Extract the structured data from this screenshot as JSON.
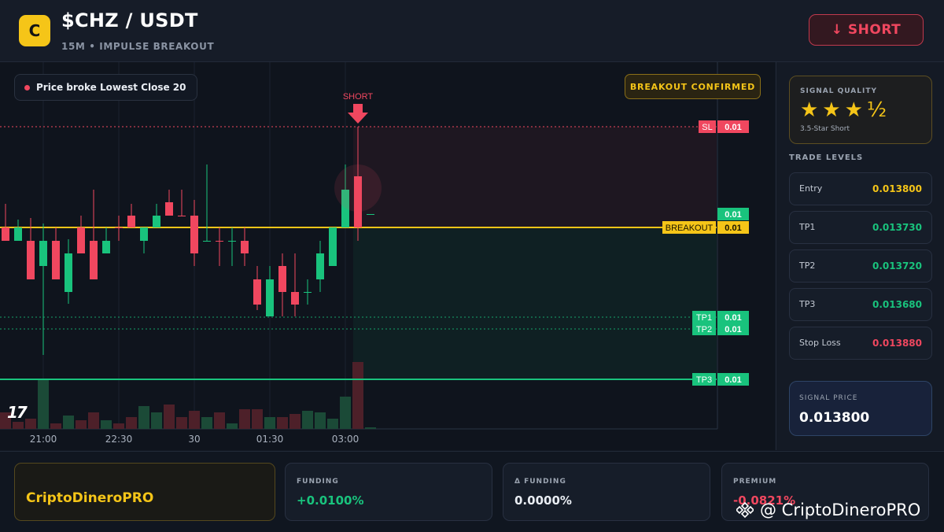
{
  "header": {
    "logo_letter": "C",
    "pair": "$CHZ / USDT",
    "subtitle": "15M • IMPULSE BREAKOUT",
    "action_label": "↓ SHORT"
  },
  "chart": {
    "info_badge": "Price broke Lowest Close 20",
    "confirm_badge": "BREAKOUT CONFIRMED",
    "signal_marker": "SHORT",
    "tv_logo": "17",
    "x_labels": [
      "21:00",
      "22:30",
      "30",
      "01:30",
      "03:00"
    ],
    "level_lines": [
      {
        "label": "SL",
        "value": "0.01",
        "color": "#f0475f"
      },
      {
        "label": "",
        "value": "0.01",
        "color": "#19c37d"
      },
      {
        "label": "BREAKOUT",
        "value": "0.01",
        "color": "#f5c518"
      },
      {
        "label": "TP1",
        "value": "0.01",
        "color": "#19c37d"
      },
      {
        "label": "TP2",
        "value": "0.01",
        "color": "#19c37d"
      },
      {
        "label": "TP3",
        "value": "0.01",
        "color": "#19c37d"
      }
    ]
  },
  "side": {
    "quality_title": "SIGNAL QUALITY",
    "stars": "★★★½",
    "rating": 3.5,
    "quality_note": "3.5-Star Short",
    "levels_title": "TRADE LEVELS",
    "levels": [
      {
        "name": "Entry",
        "value": "0.013800",
        "color": "#f5c518"
      },
      {
        "name": "TP1",
        "value": "0.013730",
        "color": "#19c37d"
      },
      {
        "name": "TP2",
        "value": "0.013720",
        "color": "#19c37d"
      },
      {
        "name": "TP3",
        "value": "0.013680",
        "color": "#19c37d"
      },
      {
        "name": "Stop Loss",
        "value": "0.013880",
        "color": "#f0475f"
      }
    ],
    "signal_price_title": "SIGNAL PRICE",
    "signal_price": "0.013800"
  },
  "footer": {
    "brand": "CriptoDineroPRO",
    "funding_title": "FUNDING",
    "funding_value": "+0.0100%",
    "delta_funding_title": "Δ FUNDING",
    "delta_funding_value": "0.0000%",
    "premium_title": "PREMIUM",
    "premium_value": "-0.0821%",
    "watermark": "@ CriptoDineroPRO"
  },
  "colors": {
    "accent": "#f5c518",
    "up": "#19c37d",
    "down": "#f0475f"
  }
}
